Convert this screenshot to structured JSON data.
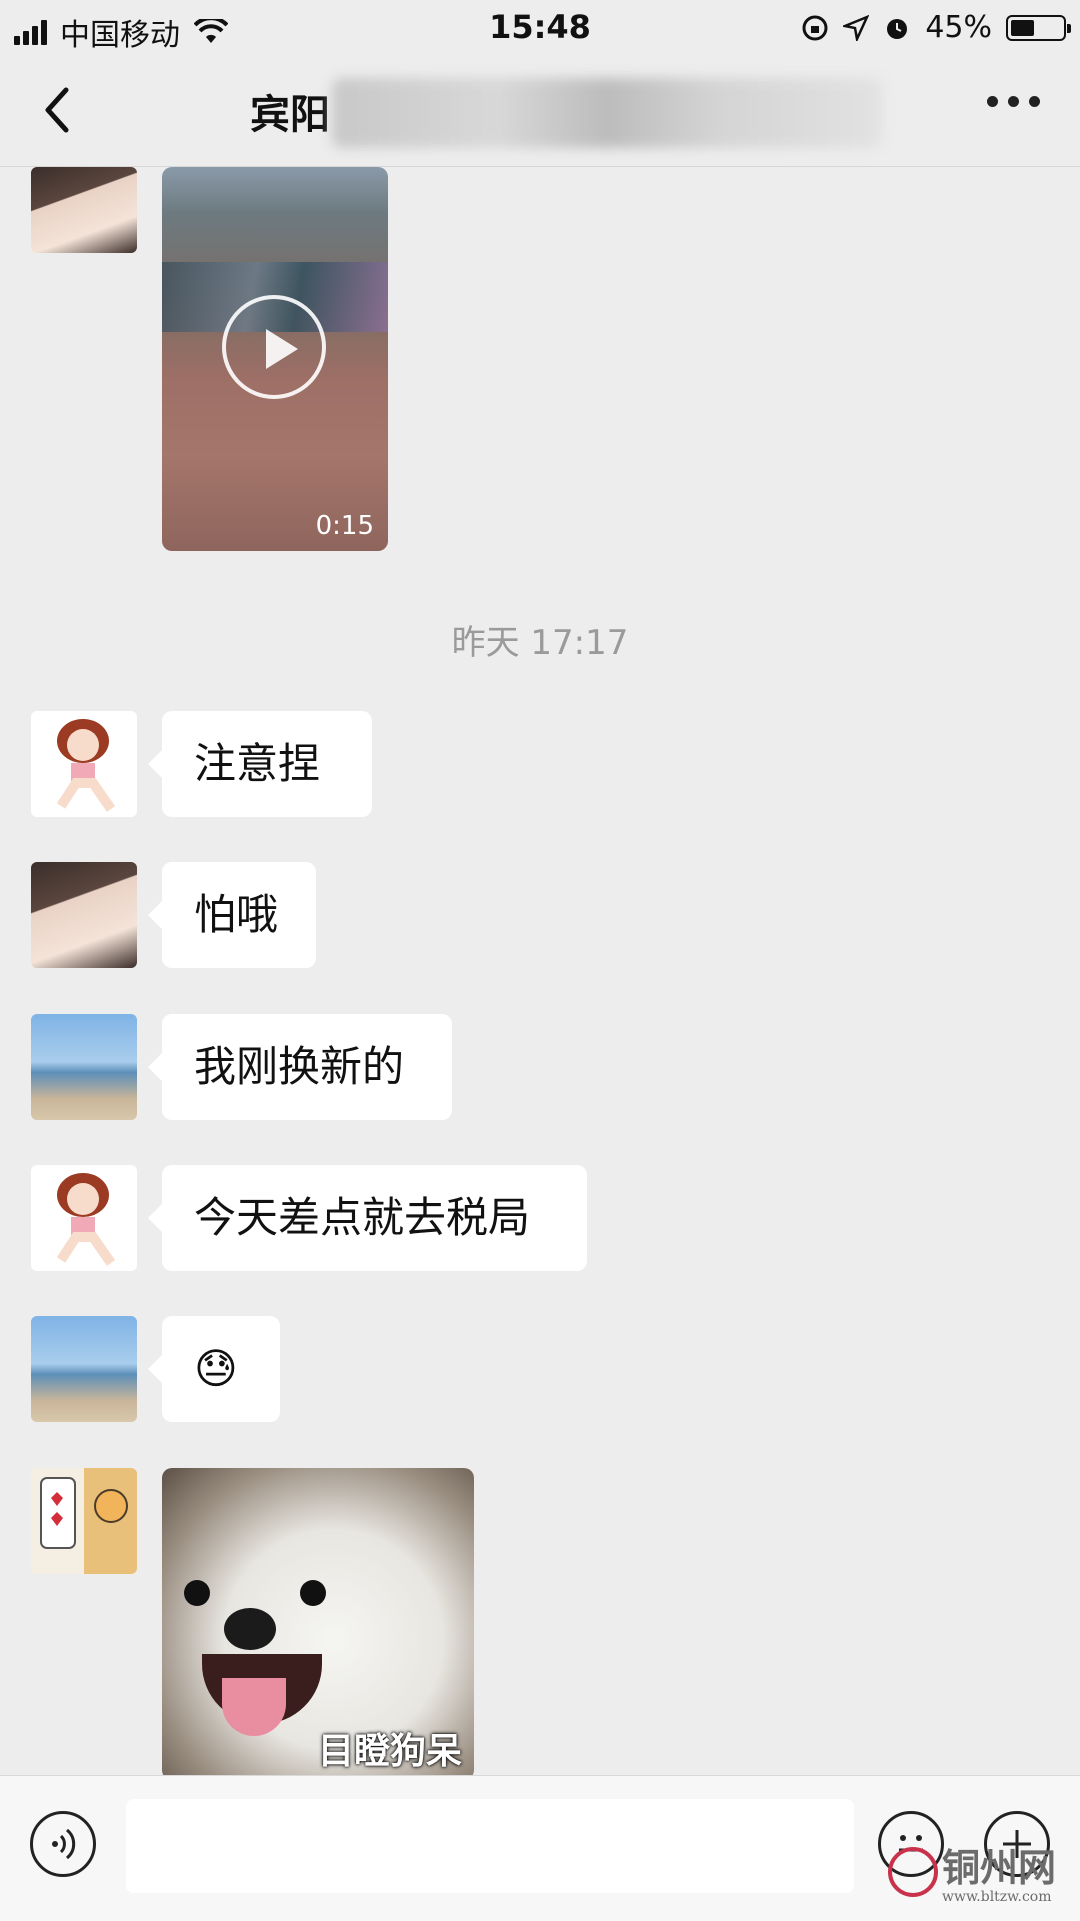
{
  "status_bar": {
    "carrier": "中国移动",
    "time": "15:48",
    "battery": "45%",
    "battery_level": 0.45
  },
  "nav": {
    "title": "宾阳",
    "title_blurred": true
  },
  "chat": {
    "video_message": {
      "duration": "0:15"
    },
    "timestamp": "昨天 17:17",
    "messages": [
      {
        "avatar": "cartoon-girl-avatar",
        "text": "注意捏"
      },
      {
        "avatar": "girl-photo-avatar",
        "text": "怕哦"
      },
      {
        "avatar": "beach-avatar",
        "text": "我刚换新的"
      },
      {
        "avatar": "cartoon-girl-avatar",
        "text": "今天差点就去税局"
      },
      {
        "avatar": "beach-avatar",
        "text": "😓"
      }
    ],
    "sticker_message": {
      "caption": "目瞪狗呆"
    }
  },
  "input_bar": {
    "voice_icon": "voice-icon",
    "emoji_icon": "emoji-icon",
    "plus_icon": "plus-icon",
    "text_value": ""
  },
  "watermark": {
    "text": "铜州网",
    "url": "www.bltzw.com"
  },
  "colors": {
    "background": "#ededed",
    "bubble": "#ffffff",
    "timestamp": "#9a9a9a"
  }
}
